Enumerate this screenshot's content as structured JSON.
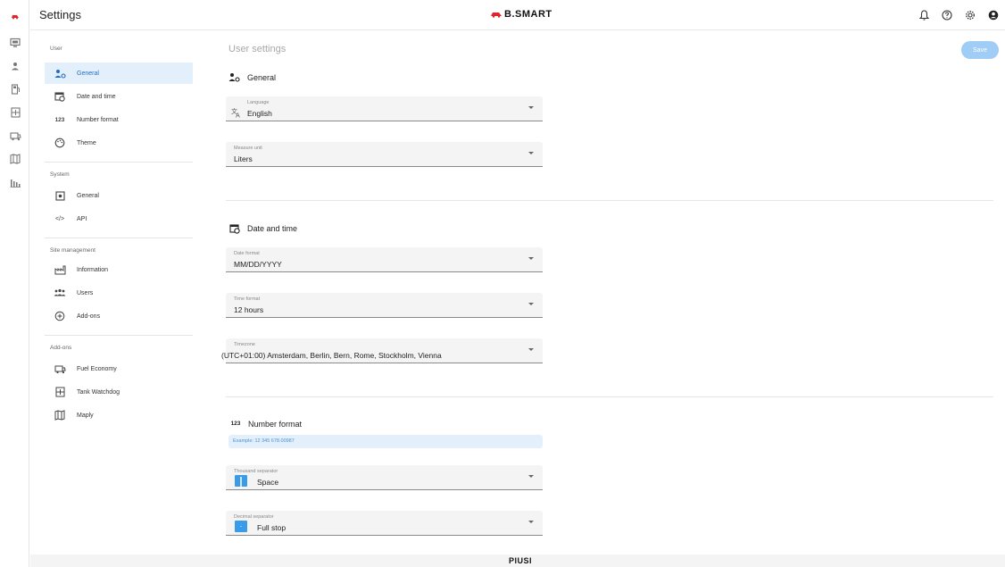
{
  "app": {
    "title": "Settings",
    "brand": "B.SMART",
    "footer_brand": "PIUSI"
  },
  "colors": {
    "accent": "#1e6fc0",
    "active_bg": "#e3f0fc",
    "save_disabled": "#9fcdf5",
    "brand_red": "#e0262c",
    "swatch_blue": "#3a9be8"
  },
  "rail": [
    "red-car-logo-icon",
    "monitor-icon",
    "person-icon",
    "dispenser-icon",
    "tank-icon",
    "truck-icon",
    "map-icon",
    "bar-chart-icon"
  ],
  "top_icons": [
    "bell-icon",
    "help-icon",
    "gear-icon",
    "account-icon"
  ],
  "sidenav": {
    "user_label": "User",
    "user_items": [
      {
        "label": "General",
        "icon": "user-gear-icon"
      },
      {
        "label": "Date and time",
        "icon": "calendar-clock-icon"
      },
      {
        "label": "Number format",
        "icon": "123-icon",
        "icon_text": "123"
      },
      {
        "label": "Theme",
        "icon": "palette-icon"
      }
    ],
    "system_label": "System",
    "system_items": [
      {
        "label": "General",
        "icon": "system-settings-icon"
      },
      {
        "label": "API",
        "icon": "code-icon",
        "icon_text": "</>"
      }
    ],
    "site_label": "Site management",
    "site_items": [
      {
        "label": "Information",
        "icon": "factory-icon"
      },
      {
        "label": "Users",
        "icon": "group-icon"
      },
      {
        "label": "Add-ons",
        "icon": "plus-circle-icon"
      }
    ],
    "addons_label": "Add-ons",
    "addon_items": [
      {
        "label": "Fuel Economy",
        "icon": "truck-icon"
      },
      {
        "label": "Tank Watchdog",
        "icon": "tank-icon"
      },
      {
        "label": "Maply",
        "icon": "map-icon"
      }
    ]
  },
  "main": {
    "title": "User settings",
    "save_label": "Save",
    "general": {
      "heading": "General",
      "language": {
        "label": "Language",
        "value": "English"
      },
      "measure": {
        "label": "Measure unit",
        "value": "Liters"
      }
    },
    "datetime": {
      "heading": "Date and time",
      "date_format": {
        "label": "Date format",
        "value": "MM/DD/YYYY"
      },
      "time_format": {
        "label": "Time format",
        "value": "12 hours"
      },
      "timezone": {
        "label": "Timezone",
        "value": "(UTC+01:00) Amsterdam, Berlin, Bern, Rome, Stockholm, Vienna"
      }
    },
    "number": {
      "heading": "Number format",
      "heading_icon_text": "123",
      "example": "Example: 12 345 678.00987",
      "thousand": {
        "label": "Thousand separator",
        "value": "Space"
      },
      "decimal": {
        "label": "Decimal separator",
        "value": "Full stop",
        "swatch_text": "."
      }
    }
  }
}
